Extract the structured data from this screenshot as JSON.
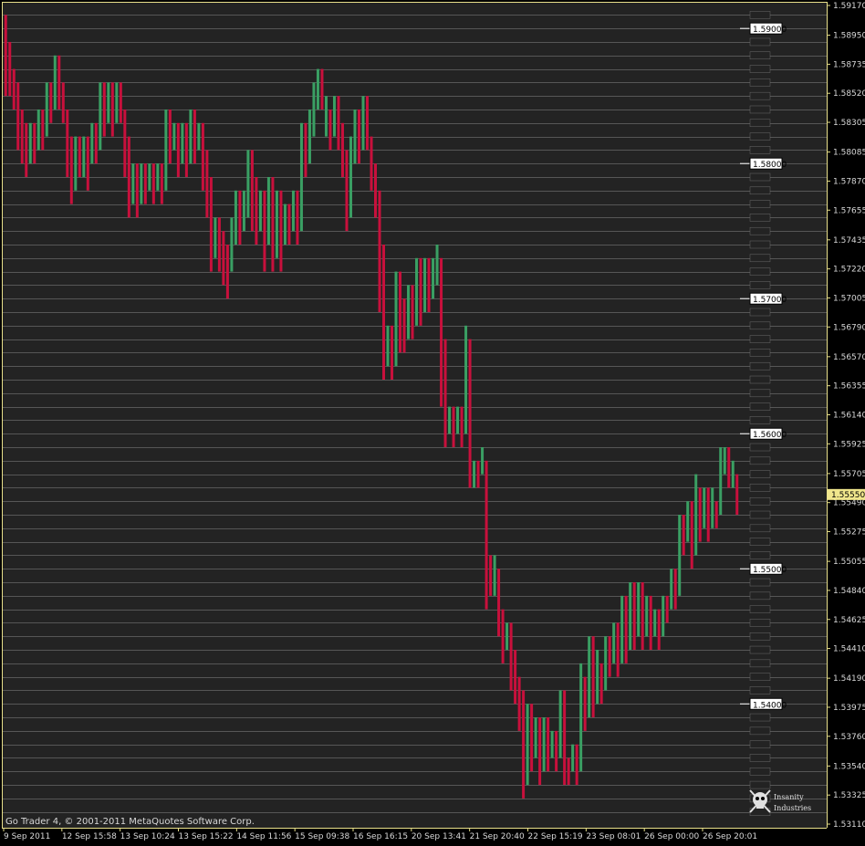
{
  "footer": {
    "copyright": "Go Trader 4, © 2001-2011 MetaQuotes Software Corp."
  },
  "logo": {
    "line1": "Insanity",
    "line2": "Industries",
    "icon": "skull-crossbones-icon"
  },
  "colors": {
    "background": "#000000",
    "plot_background": "#232323",
    "grid": "#8a8a8a",
    "frame": "#e8e08a",
    "up_bar": "#3a9f63",
    "down_bar": "#c8103c",
    "current_price_bg": "#f0e68c",
    "level_marker_bg": "#ffffff"
  },
  "chart_data": {
    "type": "renko",
    "symbol_info": "",
    "y_range": [
      1.5311,
      1.5917
    ],
    "y_ticks": [
      "1.59170",
      "1.58950",
      "1.58735",
      "1.58520",
      "1.58305",
      "1.58085",
      "1.57870",
      "1.57655",
      "1.57435",
      "1.57220",
      "1.57005",
      "1.56790",
      "1.56570",
      "1.56355",
      "1.56140",
      "1.55925",
      "1.55705",
      "1.55490",
      "1.55275",
      "1.55055",
      "1.54840",
      "1.54625",
      "1.54410",
      "1.54190",
      "1.53975",
      "1.53760",
      "1.53540",
      "1.53325",
      "1.53110"
    ],
    "current_price": "1.55550",
    "level_markers": [
      "1.59000",
      "1.58000",
      "1.57000",
      "1.56000",
      "1.55000",
      "1.54000"
    ],
    "x_labels": [
      "9 Sep 2011",
      "12 Sep 15:58",
      "13 Sep 10:24",
      "13 Sep 15:22",
      "14 Sep 11:56",
      "15 Sep 09:38",
      "16 Sep 16:15",
      "20 Sep 13:41",
      "21 Sep 20:40",
      "22 Sep 15:19",
      "23 Sep 08:01",
      "26 Sep 00:00",
      "26 Sep 20:01"
    ],
    "bars": [
      {
        "dir": "down",
        "open": 1.591,
        "close": 1.585
      },
      {
        "dir": "down",
        "open": 1.589,
        "close": 1.585
      },
      {
        "dir": "down",
        "open": 1.587,
        "close": 1.584
      },
      {
        "dir": "down",
        "open": 1.586,
        "close": 1.581
      },
      {
        "dir": "down",
        "open": 1.584,
        "close": 1.58
      },
      {
        "dir": "down",
        "open": 1.583,
        "close": 1.579
      },
      {
        "dir": "up",
        "open": 1.58,
        "close": 1.583
      },
      {
        "dir": "down",
        "open": 1.583,
        "close": 1.58
      },
      {
        "dir": "up",
        "open": 1.581,
        "close": 1.584
      },
      {
        "dir": "down",
        "open": 1.584,
        "close": 1.581
      },
      {
        "dir": "up",
        "open": 1.582,
        "close": 1.586
      },
      {
        "dir": "down",
        "open": 1.586,
        "close": 1.583
      },
      {
        "dir": "up",
        "open": 1.584,
        "close": 1.588
      },
      {
        "dir": "down",
        "open": 1.588,
        "close": 1.584
      },
      {
        "dir": "down",
        "open": 1.586,
        "close": 1.583
      },
      {
        "dir": "down",
        "open": 1.584,
        "close": 1.579
      },
      {
        "dir": "down",
        "open": 1.582,
        "close": 1.577
      },
      {
        "dir": "up",
        "open": 1.578,
        "close": 1.582
      },
      {
        "dir": "down",
        "open": 1.582,
        "close": 1.579
      },
      {
        "dir": "up",
        "open": 1.579,
        "close": 1.582
      },
      {
        "dir": "down",
        "open": 1.582,
        "close": 1.578
      },
      {
        "dir": "up",
        "open": 1.58,
        "close": 1.583
      },
      {
        "dir": "down",
        "open": 1.583,
        "close": 1.58
      },
      {
        "dir": "up",
        "open": 1.581,
        "close": 1.586
      },
      {
        "dir": "down",
        "open": 1.586,
        "close": 1.582
      },
      {
        "dir": "up",
        "open": 1.583,
        "close": 1.586
      },
      {
        "dir": "down",
        "open": 1.586,
        "close": 1.582
      },
      {
        "dir": "up",
        "open": 1.583,
        "close": 1.586
      },
      {
        "dir": "down",
        "open": 1.586,
        "close": 1.583
      },
      {
        "dir": "down",
        "open": 1.584,
        "close": 1.579
      },
      {
        "dir": "down",
        "open": 1.582,
        "close": 1.576
      },
      {
        "dir": "up",
        "open": 1.577,
        "close": 1.58
      },
      {
        "dir": "down",
        "open": 1.58,
        "close": 1.576
      },
      {
        "dir": "up",
        "open": 1.577,
        "close": 1.58
      },
      {
        "dir": "down",
        "open": 1.58,
        "close": 1.577
      },
      {
        "dir": "up",
        "open": 1.578,
        "close": 1.58
      },
      {
        "dir": "down",
        "open": 1.58,
        "close": 1.577
      },
      {
        "dir": "up",
        "open": 1.578,
        "close": 1.58
      },
      {
        "dir": "down",
        "open": 1.58,
        "close": 1.577
      },
      {
        "dir": "up",
        "open": 1.578,
        "close": 1.584
      },
      {
        "dir": "down",
        "open": 1.584,
        "close": 1.58
      },
      {
        "dir": "up",
        "open": 1.581,
        "close": 1.583
      },
      {
        "dir": "down",
        "open": 1.583,
        "close": 1.579
      },
      {
        "dir": "up",
        "open": 1.58,
        "close": 1.583
      },
      {
        "dir": "down",
        "open": 1.583,
        "close": 1.579
      },
      {
        "dir": "up",
        "open": 1.58,
        "close": 1.584
      },
      {
        "dir": "down",
        "open": 1.584,
        "close": 1.58
      },
      {
        "dir": "up",
        "open": 1.581,
        "close": 1.583
      },
      {
        "dir": "down",
        "open": 1.583,
        "close": 1.578
      },
      {
        "dir": "down",
        "open": 1.581,
        "close": 1.576
      },
      {
        "dir": "down",
        "open": 1.579,
        "close": 1.572
      },
      {
        "dir": "up",
        "open": 1.573,
        "close": 1.576
      },
      {
        "dir": "down",
        "open": 1.576,
        "close": 1.572
      },
      {
        "dir": "down",
        "open": 1.575,
        "close": 1.571
      },
      {
        "dir": "down",
        "open": 1.574,
        "close": 1.57
      },
      {
        "dir": "up",
        "open": 1.572,
        "close": 1.576
      },
      {
        "dir": "up",
        "open": 1.574,
        "close": 1.578
      },
      {
        "dir": "down",
        "open": 1.578,
        "close": 1.574
      },
      {
        "dir": "up",
        "open": 1.575,
        "close": 1.578
      },
      {
        "dir": "up",
        "open": 1.576,
        "close": 1.581
      },
      {
        "dir": "down",
        "open": 1.581,
        "close": 1.575
      },
      {
        "dir": "down",
        "open": 1.579,
        "close": 1.574
      },
      {
        "dir": "up",
        "open": 1.575,
        "close": 1.578
      },
      {
        "dir": "down",
        "open": 1.578,
        "close": 1.572
      },
      {
        "dir": "up",
        "open": 1.574,
        "close": 1.579
      },
      {
        "dir": "down",
        "open": 1.579,
        "close": 1.572
      },
      {
        "dir": "up",
        "open": 1.573,
        "close": 1.578
      },
      {
        "dir": "down",
        "open": 1.578,
        "close": 1.572
      },
      {
        "dir": "up",
        "open": 1.574,
        "close": 1.577
      },
      {
        "dir": "down",
        "open": 1.577,
        "close": 1.574
      },
      {
        "dir": "up",
        "open": 1.575,
        "close": 1.578
      },
      {
        "dir": "down",
        "open": 1.578,
        "close": 1.574
      },
      {
        "dir": "up",
        "open": 1.575,
        "close": 1.583
      },
      {
        "dir": "down",
        "open": 1.583,
        "close": 1.579
      },
      {
        "dir": "up",
        "open": 1.58,
        "close": 1.584
      },
      {
        "dir": "up",
        "open": 1.582,
        "close": 1.586
      },
      {
        "dir": "up",
        "open": 1.584,
        "close": 1.587
      },
      {
        "dir": "down",
        "open": 1.587,
        "close": 1.584
      },
      {
        "dir": "up",
        "open": 1.582,
        "close": 1.585
      },
      {
        "dir": "down",
        "open": 1.584,
        "close": 1.581
      },
      {
        "dir": "up",
        "open": 1.582,
        "close": 1.585
      },
      {
        "dir": "down",
        "open": 1.585,
        "close": 1.581
      },
      {
        "dir": "down",
        "open": 1.583,
        "close": 1.579
      },
      {
        "dir": "down",
        "open": 1.581,
        "close": 1.575
      },
      {
        "dir": "up",
        "open": 1.576,
        "close": 1.582
      },
      {
        "dir": "up",
        "open": 1.58,
        "close": 1.584
      },
      {
        "dir": "down",
        "open": 1.584,
        "close": 1.58
      },
      {
        "dir": "up",
        "open": 1.581,
        "close": 1.585
      },
      {
        "dir": "down",
        "open": 1.585,
        "close": 1.581
      },
      {
        "dir": "down",
        "open": 1.582,
        "close": 1.578
      },
      {
        "dir": "down",
        "open": 1.58,
        "close": 1.576
      },
      {
        "dir": "down",
        "open": 1.578,
        "close": 1.569
      },
      {
        "dir": "down",
        "open": 1.574,
        "close": 1.564
      },
      {
        "dir": "up",
        "open": 1.565,
        "close": 1.568
      },
      {
        "dir": "down",
        "open": 1.568,
        "close": 1.564
      },
      {
        "dir": "up",
        "open": 1.565,
        "close": 1.572
      },
      {
        "dir": "down",
        "open": 1.572,
        "close": 1.566
      },
      {
        "dir": "down",
        "open": 1.57,
        "close": 1.566
      },
      {
        "dir": "up",
        "open": 1.567,
        "close": 1.571
      },
      {
        "dir": "down",
        "open": 1.571,
        "close": 1.567
      },
      {
        "dir": "up",
        "open": 1.568,
        "close": 1.573
      },
      {
        "dir": "down",
        "open": 1.573,
        "close": 1.568
      },
      {
        "dir": "up",
        "open": 1.569,
        "close": 1.573
      },
      {
        "dir": "down",
        "open": 1.573,
        "close": 1.569
      },
      {
        "dir": "up",
        "open": 1.57,
        "close": 1.573
      },
      {
        "dir": "up",
        "open": 1.571,
        "close": 1.574
      },
      {
        "dir": "down",
        "open": 1.573,
        "close": 1.562
      },
      {
        "dir": "down",
        "open": 1.567,
        "close": 1.559
      },
      {
        "dir": "up",
        "open": 1.56,
        "close": 1.562
      },
      {
        "dir": "down",
        "open": 1.562,
        "close": 1.559
      },
      {
        "dir": "up",
        "open": 1.56,
        "close": 1.562
      },
      {
        "dir": "down",
        "open": 1.562,
        "close": 1.559
      },
      {
        "dir": "up",
        "open": 1.56,
        "close": 1.568
      },
      {
        "dir": "down",
        "open": 1.567,
        "close": 1.556
      },
      {
        "dir": "up",
        "open": 1.556,
        "close": 1.558
      },
      {
        "dir": "down",
        "open": 1.558,
        "close": 1.556
      },
      {
        "dir": "up",
        "open": 1.557,
        "close": 1.559
      },
      {
        "dir": "down",
        "open": 1.558,
        "close": 1.547
      },
      {
        "dir": "down",
        "open": 1.551,
        "close": 1.548
      },
      {
        "dir": "up",
        "open": 1.548,
        "close": 1.551
      },
      {
        "dir": "down",
        "open": 1.55,
        "close": 1.545
      },
      {
        "dir": "down",
        "open": 1.547,
        "close": 1.543
      },
      {
        "dir": "up",
        "open": 1.544,
        "close": 1.546
      },
      {
        "dir": "down",
        "open": 1.546,
        "close": 1.541
      },
      {
        "dir": "down",
        "open": 1.544,
        "close": 1.54
      },
      {
        "dir": "down",
        "open": 1.542,
        "close": 1.538
      },
      {
        "dir": "down",
        "open": 1.541,
        "close": 1.533
      },
      {
        "dir": "up",
        "open": 1.534,
        "close": 1.54
      },
      {
        "dir": "down",
        "open": 1.54,
        "close": 1.535
      },
      {
        "dir": "up",
        "open": 1.536,
        "close": 1.539
      },
      {
        "dir": "down",
        "open": 1.539,
        "close": 1.534
      },
      {
        "dir": "up",
        "open": 1.535,
        "close": 1.539
      },
      {
        "dir": "down",
        "open": 1.539,
        "close": 1.535
      },
      {
        "dir": "up",
        "open": 1.536,
        "close": 1.538
      },
      {
        "dir": "down",
        "open": 1.538,
        "close": 1.535
      },
      {
        "dir": "up",
        "open": 1.536,
        "close": 1.541
      },
      {
        "dir": "down",
        "open": 1.541,
        "close": 1.534
      },
      {
        "dir": "down",
        "open": 1.536,
        "close": 1.534
      },
      {
        "dir": "up",
        "open": 1.535,
        "close": 1.537
      },
      {
        "dir": "down",
        "open": 1.537,
        "close": 1.534
      },
      {
        "dir": "up",
        "open": 1.535,
        "close": 1.543
      },
      {
        "dir": "down",
        "open": 1.542,
        "close": 1.538
      },
      {
        "dir": "up",
        "open": 1.539,
        "close": 1.545
      },
      {
        "dir": "down",
        "open": 1.545,
        "close": 1.539
      },
      {
        "dir": "up",
        "open": 1.54,
        "close": 1.544
      },
      {
        "dir": "down",
        "open": 1.543,
        "close": 1.54
      },
      {
        "dir": "up",
        "open": 1.541,
        "close": 1.545
      },
      {
        "dir": "down",
        "open": 1.545,
        "close": 1.542
      },
      {
        "dir": "up",
        "open": 1.543,
        "close": 1.546
      },
      {
        "dir": "down",
        "open": 1.546,
        "close": 1.542
      },
      {
        "dir": "up",
        "open": 1.543,
        "close": 1.548
      },
      {
        "dir": "down",
        "open": 1.548,
        "close": 1.543
      },
      {
        "dir": "up",
        "open": 1.544,
        "close": 1.549
      },
      {
        "dir": "down",
        "open": 1.549,
        "close": 1.544
      },
      {
        "dir": "up",
        "open": 1.545,
        "close": 1.549
      },
      {
        "dir": "down",
        "open": 1.549,
        "close": 1.544
      },
      {
        "dir": "up",
        "open": 1.545,
        "close": 1.548
      },
      {
        "dir": "down",
        "open": 1.548,
        "close": 1.544
      },
      {
        "dir": "up",
        "open": 1.545,
        "close": 1.547
      },
      {
        "dir": "down",
        "open": 1.547,
        "close": 1.544
      },
      {
        "dir": "up",
        "open": 1.545,
        "close": 1.548
      },
      {
        "dir": "down",
        "open": 1.548,
        "close": 1.546
      },
      {
        "dir": "up",
        "open": 1.547,
        "close": 1.55
      },
      {
        "dir": "down",
        "open": 1.55,
        "close": 1.547
      },
      {
        "dir": "up",
        "open": 1.548,
        "close": 1.554
      },
      {
        "dir": "down",
        "open": 1.554,
        "close": 1.551
      },
      {
        "dir": "up",
        "open": 1.552,
        "close": 1.555
      },
      {
        "dir": "down",
        "open": 1.555,
        "close": 1.55
      },
      {
        "dir": "up",
        "open": 1.551,
        "close": 1.557
      },
      {
        "dir": "down",
        "open": 1.556,
        "close": 1.552
      },
      {
        "dir": "up",
        "open": 1.553,
        "close": 1.556
      },
      {
        "dir": "down",
        "open": 1.556,
        "close": 1.552
      },
      {
        "dir": "up",
        "open": 1.553,
        "close": 1.556
      },
      {
        "dir": "down",
        "open": 1.555,
        "close": 1.553
      },
      {
        "dir": "up",
        "open": 1.554,
        "close": 1.559
      },
      {
        "dir": "up",
        "open": 1.557,
        "close": 1.559
      },
      {
        "dir": "down",
        "open": 1.559,
        "close": 1.556
      },
      {
        "dir": "up",
        "open": 1.556,
        "close": 1.558
      },
      {
        "dir": "down",
        "open": 1.557,
        "close": 1.554
      }
    ]
  }
}
